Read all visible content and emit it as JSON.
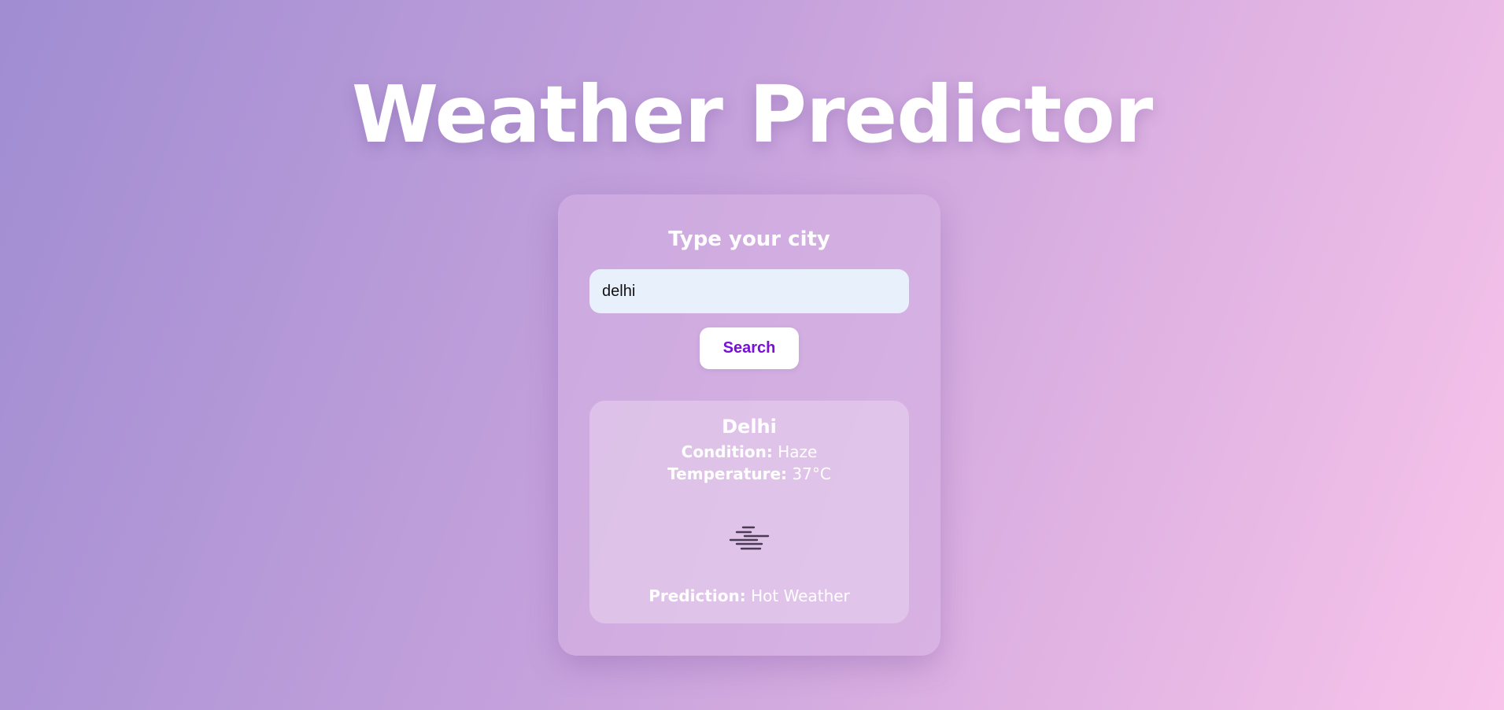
{
  "page": {
    "title": "Weather Predictor"
  },
  "search": {
    "heading": "Type your city",
    "input_value": "delhi",
    "button_label": "Search"
  },
  "result": {
    "city": "Delhi",
    "condition_label": "Condition:",
    "condition_value": "Haze",
    "temperature_label": "Temperature:",
    "temperature_value": "37°C",
    "icon": "haze-icon",
    "prediction_label": "Prediction:",
    "prediction_value": "Hot Weather"
  },
  "colors": {
    "accent": "#7a10d8",
    "input_bg": "#e8f0fb",
    "text": "#ffffff"
  }
}
